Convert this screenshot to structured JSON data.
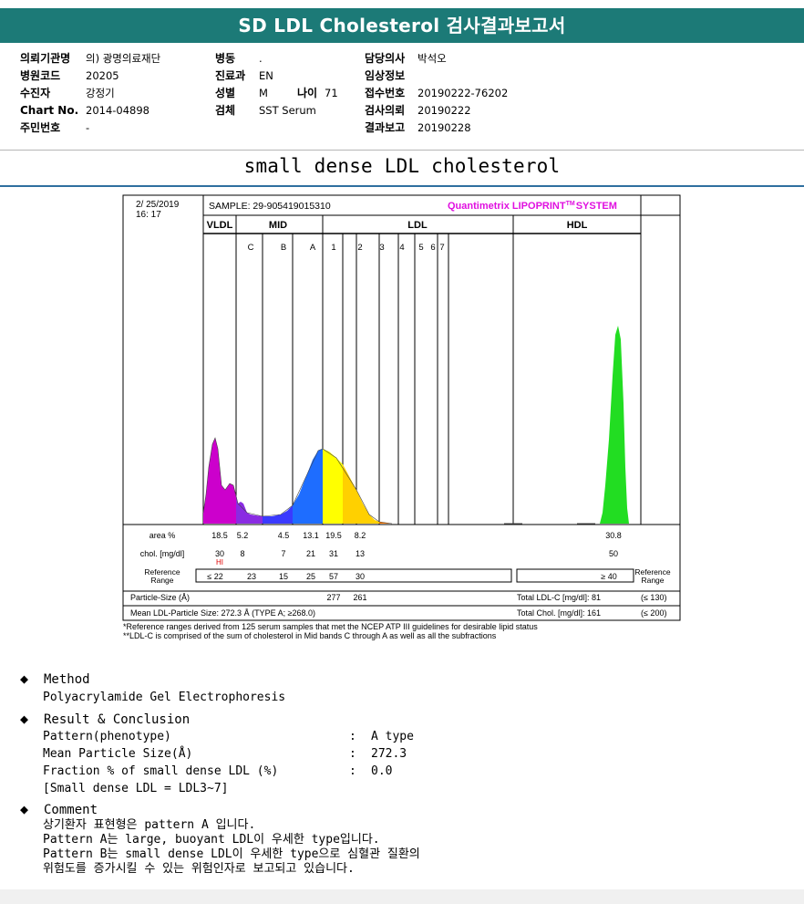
{
  "title": "SD LDL Cholesterol 검사결과보고서",
  "info": {
    "col1": [
      {
        "label": "의뢰기관명",
        "value": "의) 광명의료재단"
      },
      {
        "label": "병원코드",
        "value": "20205"
      },
      {
        "label": "수진자",
        "value": "강정기"
      },
      {
        "label": "Chart No.",
        "value": "2014-04898"
      },
      {
        "label": "주민번호",
        "value": "-"
      }
    ],
    "col2": [
      {
        "label": "병동",
        "value": "."
      },
      {
        "label": "진료과",
        "value": "EN"
      },
      {
        "label": "성별",
        "value": "M"
      },
      {
        "label": "검체",
        "value": "SST Serum"
      }
    ],
    "age_label": "나이",
    "age_value": "71",
    "col3": [
      {
        "label": "담당의사",
        "value": "박석오"
      },
      {
        "label": "임상정보",
        "value": ""
      },
      {
        "label": "접수번호",
        "value": "20190222-76202"
      },
      {
        "label": "검사의뢰",
        "value": "20190222"
      },
      {
        "label": "결과보고",
        "value": "20190228"
      }
    ]
  },
  "subtitle": "small dense LDL cholesterol",
  "chart_data": {
    "type": "area",
    "date": "2/ 25/2019",
    "time": "16: 17",
    "sample": "SAMPLE:  29-905419015310",
    "brand": "Quantimetrix LIPOPRINT",
    "brand_tm": "TM",
    "brand_suffix": "SYSTEM",
    "groups": [
      "VLDL",
      "MID",
      "LDL",
      "HDL"
    ],
    "bands": [
      "C",
      "B",
      "A",
      "1",
      "2",
      "3",
      "4",
      "5",
      "6",
      "7"
    ],
    "band_colors": {
      "VLDL": "#cc00cc",
      "C": "#8a2be2",
      "B": "#3a3aff",
      "A": "#1e6dff",
      "1": "#ffff00",
      "2": "#ffd000",
      "3": "#ff7a00",
      "HDL": "#22dd22"
    },
    "rows": {
      "area_label": "area %",
      "area": [
        "18.5",
        "5.2",
        "4.5",
        "13.1",
        "19.5",
        "8.2",
        "30.8"
      ],
      "chol_label": "chol. [mg/dl]",
      "chol": [
        "30",
        "8",
        "7",
        "21",
        "31",
        "13",
        "50"
      ],
      "hi_flag": "HI",
      "ref_label": "Reference Range",
      "ref": [
        "≤ 22",
        "23",
        "15",
        "25",
        "57",
        "30"
      ],
      "ref_hdl": "≥ 40",
      "ref_label_right": "Reference Range",
      "particle_label": "Particle-Size (Å)",
      "particle": [
        "277",
        "261"
      ],
      "mean_label": "Mean LDL-Particle Size:  272.3 Å  (TYPE A; ≥268.0)",
      "total_ldl_label": "Total LDL-C [mg/dl]:  81",
      "total_ldl_ref": "(≤ 130)",
      "total_chol_label": "Total Chol. [mg/dl]:  161",
      "total_chol_ref": "(≤ 200)"
    }
  },
  "footnotes": [
    "*Reference ranges derived from 125 serum samples that met the NCEP ATP III guidelines for desirable lipid status",
    "**LDL-C is comprised of the sum of cholesterol in Mid bands C through A as well as all the subfractions"
  ],
  "sections": {
    "method_title": "Method",
    "method_text": "Polyacrylamide Gel Electrophoresis",
    "result_title": "Result & Conclusion",
    "result_rows": [
      {
        "k": "Pattern(phenotype)",
        "v": "A type"
      },
      {
        "k": "Mean Particle Size(Å)",
        "v": "272.3"
      },
      {
        "k": "Fraction % of small dense LDL (%)",
        "v": "0.0"
      }
    ],
    "result_note": "[Small dense LDL = LDL3~7]",
    "comment_title": "Comment",
    "comment_lines": [
      "상기환자 표현형은 pattern A 입니다.",
      "Pattern A는 large, buoyant LDL이 우세한 type입니다.",
      "Pattern B는 small dense LDL이 우세한 type으로 심혈관 질환의",
      "위험도를 증가시킬 수 있는 위험인자로 보고되고 있습니다."
    ]
  }
}
